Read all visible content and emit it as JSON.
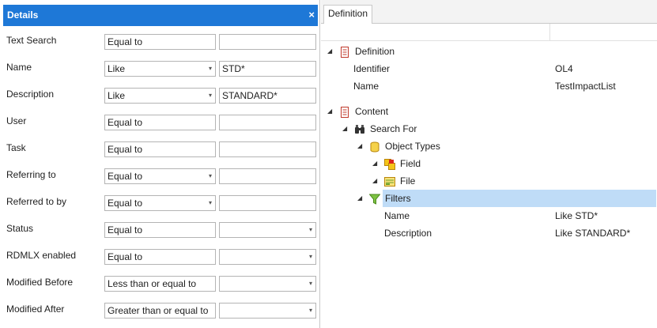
{
  "details": {
    "title": "Details",
    "close_glyph": "×",
    "fields": [
      {
        "label": "Text Search",
        "operator": "Equal to",
        "op_dropdown": false,
        "value": "",
        "value_dropdown": false
      },
      {
        "label": "Name",
        "operator": "Like",
        "op_dropdown": true,
        "value": "STD*",
        "value_dropdown": false
      },
      {
        "label": "Description",
        "operator": "Like",
        "op_dropdown": true,
        "value": "STANDARD*",
        "value_dropdown": false
      },
      {
        "label": "User",
        "operator": "Equal to",
        "op_dropdown": false,
        "value": "",
        "value_dropdown": false
      },
      {
        "label": "Task",
        "operator": "Equal to",
        "op_dropdown": false,
        "value": "",
        "value_dropdown": false
      },
      {
        "label": "Referring to",
        "operator": "Equal to",
        "op_dropdown": true,
        "value": "",
        "value_dropdown": false
      },
      {
        "label": "Referred to by",
        "operator": "Equal to",
        "op_dropdown": true,
        "value": "",
        "value_dropdown": false
      },
      {
        "label": "Status",
        "operator": "Equal to",
        "op_dropdown": false,
        "value": "",
        "value_dropdown": true
      },
      {
        "label": "RDMLX enabled",
        "operator": "Equal to",
        "op_dropdown": false,
        "value": "",
        "value_dropdown": true
      },
      {
        "label": "Modified Before",
        "operator": "Less than or equal to",
        "op_dropdown": false,
        "value": "",
        "value_dropdown": true
      },
      {
        "label": "Modified After",
        "operator": "Greater than or equal to",
        "op_dropdown": false,
        "value": "",
        "value_dropdown": true
      }
    ]
  },
  "definition_panel": {
    "tab_label": "Definition",
    "tree": [
      {
        "indent": 0,
        "toggle": true,
        "icon": "document-icon",
        "text": "Definition",
        "value": "",
        "selected": false
      },
      {
        "indent": 1,
        "toggle": false,
        "icon": "",
        "text": "Identifier",
        "value": "OL4",
        "selected": false
      },
      {
        "indent": 1,
        "toggle": false,
        "icon": "",
        "text": "Name",
        "value": "TestImpactList",
        "selected": false
      },
      {
        "indent": 0,
        "toggle": true,
        "icon": "document-icon",
        "text": "Content",
        "value": "",
        "selected": false
      },
      {
        "indent": 1,
        "toggle": true,
        "icon": "binoculars-icon",
        "text": "Search For",
        "value": "",
        "selected": false
      },
      {
        "indent": 2,
        "toggle": true,
        "icon": "database-icon",
        "text": "Object Types",
        "value": "",
        "selected": false
      },
      {
        "indent": 3,
        "toggle": true,
        "icon": "field-icon",
        "text": "Field",
        "value": "",
        "selected": false
      },
      {
        "indent": 3,
        "toggle": true,
        "icon": "file-icon",
        "text": "File",
        "value": "",
        "selected": false
      },
      {
        "indent": 2,
        "toggle": true,
        "icon": "funnel-icon",
        "text": "Filters",
        "value": "",
        "selected": true
      },
      {
        "indent": 3,
        "toggle": false,
        "icon": "",
        "text": "Name",
        "value": "Like STD*",
        "selected": false
      },
      {
        "indent": 3,
        "toggle": false,
        "icon": "",
        "text": "Description",
        "value": "Like STANDARD*",
        "selected": false
      }
    ]
  },
  "glyphs": {
    "dropdown_arrow": "▾",
    "tree_toggle": "◢"
  },
  "colors": {
    "header_blue": "#1e78d7",
    "selection": "#bfdcf7"
  }
}
